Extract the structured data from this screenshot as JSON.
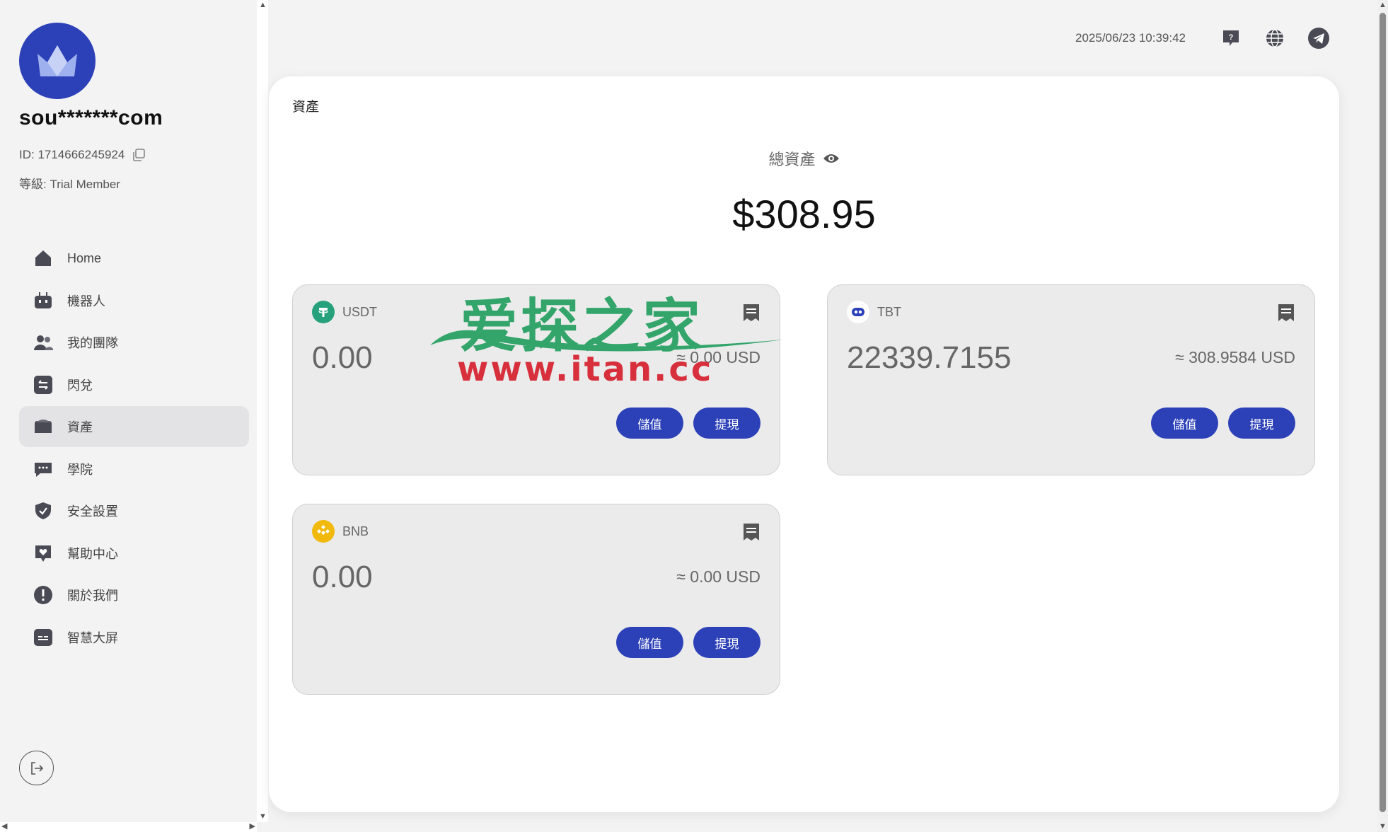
{
  "user": {
    "name": "sou*******com",
    "id_label": "ID: 1714666245924",
    "level_label": "等級: Trial Member"
  },
  "nav": {
    "items": [
      {
        "label": "Home",
        "icon": "home-icon"
      },
      {
        "label": "機器人",
        "icon": "robot-icon"
      },
      {
        "label": "我的團隊",
        "icon": "team-icon"
      },
      {
        "label": "閃兌",
        "icon": "exchange-icon"
      },
      {
        "label": "資產",
        "icon": "wallet-icon",
        "active": true
      },
      {
        "label": "學院",
        "icon": "chat-icon"
      },
      {
        "label": "安全設置",
        "icon": "shield-icon"
      },
      {
        "label": "幫助中心",
        "icon": "heart-icon"
      },
      {
        "label": "關於我們",
        "icon": "info-icon"
      },
      {
        "label": "智慧大屏",
        "icon": "screen-icon"
      }
    ]
  },
  "topbar": {
    "datetime": "2025/06/23 10:39:42"
  },
  "main": {
    "title": "資產",
    "total_label": "總資產",
    "total_value": "$308.95"
  },
  "coins": [
    {
      "symbol": "USDT",
      "amount": "0.00",
      "usd": "≈ 0.00 USD",
      "deposit": "儲值",
      "withdraw": "提現",
      "color": "#26a17b"
    },
    {
      "symbol": "TBT",
      "amount": "22339.7155",
      "usd": "≈ 308.9584 USD",
      "deposit": "儲值",
      "withdraw": "提現",
      "color": "#2c40b8"
    },
    {
      "symbol": "BNB",
      "amount": "0.00",
      "usd": "≈ 0.00 USD",
      "deposit": "儲值",
      "withdraw": "提現",
      "color": "#f0b90b"
    }
  ],
  "watermark": {
    "line1": "爱探之家",
    "line2": "www.itan.cc"
  },
  "colors": {
    "accent": "#2c40b8",
    "background": "#f3f3f4",
    "card": "#ebebec"
  }
}
